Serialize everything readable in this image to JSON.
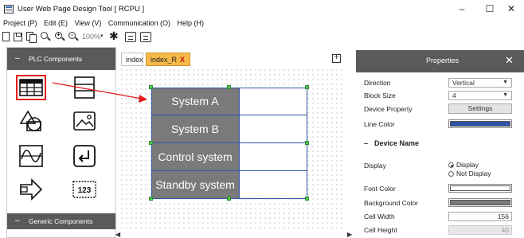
{
  "window": {
    "title": "User Web Page Design Tool [ RCPU ]",
    "min_glyph": "–",
    "max_glyph": "☐",
    "close_glyph": "✕"
  },
  "menu": [
    "Project (P)",
    "Edit (E)",
    "View (V)",
    "Communication (O)",
    "Help (H)"
  ],
  "toolbar": {
    "zoom": "100%",
    "zoom_caret": "▾",
    "icons": [
      "new-file-icon",
      "save-icon",
      "copy-icon",
      "search-icon",
      "zoom-in-icon",
      "zoom-out-icon",
      "settings-gear-icon",
      "screen-icon",
      "screen-alt-icon"
    ]
  },
  "left_panel": {
    "header_dash": "–",
    "header": "PLC Components",
    "generic_dash": "–",
    "generic_header": "Generic Components",
    "components": [
      "table-component-icon",
      "list-component-icon",
      "shape-component-icon",
      "image-component-icon",
      "graph-component-icon",
      "enter-component-icon",
      "switch-component-icon",
      "numeric-display-icon"
    ],
    "numeric_glyph": "123",
    "selected_component": "table-component-icon"
  },
  "editor": {
    "tabs": [
      {
        "label": "index"
      },
      {
        "label": "index_R",
        "close": "X",
        "active": true
      }
    ],
    "expand_glyph": "+",
    "table_rows": [
      "System A",
      "System B",
      "Control system",
      "Standby system"
    ]
  },
  "properties": {
    "title": "Properties",
    "close_glyph": "✕",
    "rows": {
      "direction_label": "Direction",
      "direction_value": "Vertical",
      "block_size_label": "Block Size",
      "block_size_value": "4",
      "device_property_label": "Device Property",
      "device_property_button": "Settings",
      "line_color_label": "Line Color",
      "line_color": "#2f54a8"
    },
    "device_name": {
      "section_dash": "–",
      "section": "Device Name",
      "display_label": "Display",
      "display_option": "Display",
      "not_display_option": "Not Display",
      "font_color_label": "Font Color",
      "font_color": "#ffffff",
      "bg_color_label": "Background Color",
      "bg_color": "#7a7a7a",
      "cell_width_label": "Cell Width",
      "cell_width": "156",
      "cell_height_label": "Cell Height",
      "cell_height": "40"
    }
  },
  "colors": {
    "panel_header": "#5a5a5a",
    "active_tab": "#f7b94a",
    "selection_box": "#e11c1c",
    "arrow": "#e11c1c",
    "handle": "#4cc84a"
  }
}
